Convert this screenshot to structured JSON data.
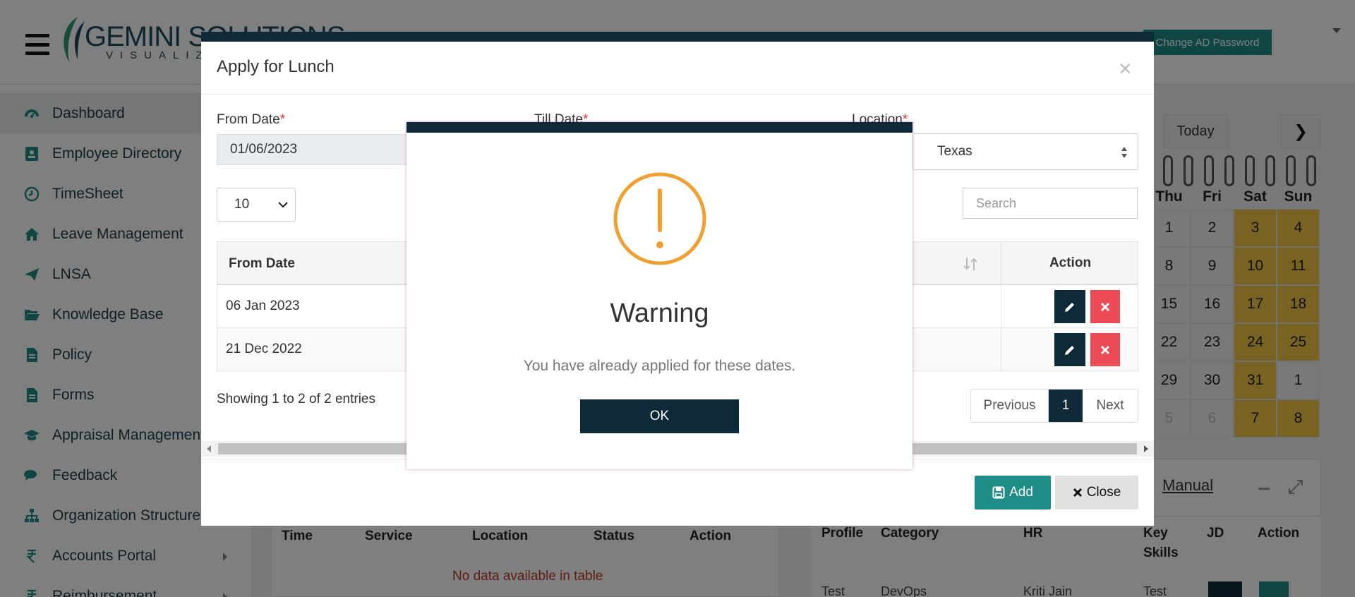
{
  "app": {
    "logo_word": "GEMINI SOLUTIONS",
    "logo_sub": "VISUALIZE",
    "change_ad_password": "Change AD Password"
  },
  "sidebar": {
    "items": [
      {
        "label": "Dashboard",
        "icon": "dashboard-icon"
      },
      {
        "label": "Employee Directory",
        "icon": "address-book-icon"
      },
      {
        "label": "TimeSheet",
        "icon": "clock-icon"
      },
      {
        "label": "Leave Management",
        "icon": "home-icon"
      },
      {
        "label": "LNSA",
        "icon": "paper-plane-icon"
      },
      {
        "label": "Knowledge Base",
        "icon": "folder-open-icon"
      },
      {
        "label": "Policy",
        "icon": "document-icon"
      },
      {
        "label": "Forms",
        "icon": "document-icon"
      },
      {
        "label": "Appraisal Management",
        "icon": "graduation-cap-icon"
      },
      {
        "label": "Feedback",
        "icon": "comments-icon"
      },
      {
        "label": "Organization Structure",
        "icon": "sitemap-icon"
      },
      {
        "label": "Accounts Portal",
        "icon": "rupee-icon"
      },
      {
        "label": "Reimbursement",
        "icon": "rupee-icon"
      }
    ]
  },
  "calendar": {
    "today_label": "Today",
    "next_label": "❯",
    "days": [
      "Thu",
      "Fri",
      "Sat",
      "Sun"
    ],
    "weeks": [
      [
        "1",
        "2",
        "3",
        "4"
      ],
      [
        "8",
        "9",
        "10",
        "11"
      ],
      [
        "15",
        "16",
        "17",
        "18"
      ],
      [
        "22",
        "23",
        "24",
        "25"
      ],
      [
        "29",
        "30",
        "31",
        "1"
      ],
      [
        "5",
        "6",
        "7",
        "8"
      ]
    ]
  },
  "manual_panel": {
    "link": "Manual",
    "columns": [
      "Profile",
      "Category",
      "HR",
      "Key Skills",
      "JD",
      "Action"
    ],
    "row": [
      "Test",
      "DevOps",
      "Kriti Jain",
      "Test"
    ]
  },
  "requests_table": {
    "columns": [
      "Time",
      "Service",
      "Location",
      "Status",
      "Action"
    ],
    "empty": "No data available in table"
  },
  "lunch_modal": {
    "title": "Apply for Lunch",
    "close_x": "×",
    "from_date_label": "From Date",
    "till_date_label": "Till Date",
    "location_label": "Location",
    "required_mark": "*",
    "from_date_value": "01/06/2023",
    "location_value": "Texas",
    "page_length": "10",
    "search_placeholder": "Search",
    "columns": {
      "from_date": "From Date",
      "action": "Action"
    },
    "rows": [
      {
        "from_date": "06 Jan 2023"
      },
      {
        "from_date": "21 Dec 2022"
      }
    ],
    "showing": "Showing 1 to 2 of 2 entries",
    "pagination": {
      "previous": "Previous",
      "page": "1",
      "next": "Next"
    },
    "add_label": "Add",
    "close_label": "Close"
  },
  "warning_dialog": {
    "title": "Warning",
    "message": "You have already applied for these dates.",
    "ok_label": "OK",
    "icon": "exclamation-circle-icon"
  },
  "colors": {
    "navy": "#0e2a38",
    "teal": "#1e8c87",
    "danger": "#ec4a55",
    "warning_orange": "#f0a030",
    "weekend": "#f2c744"
  }
}
